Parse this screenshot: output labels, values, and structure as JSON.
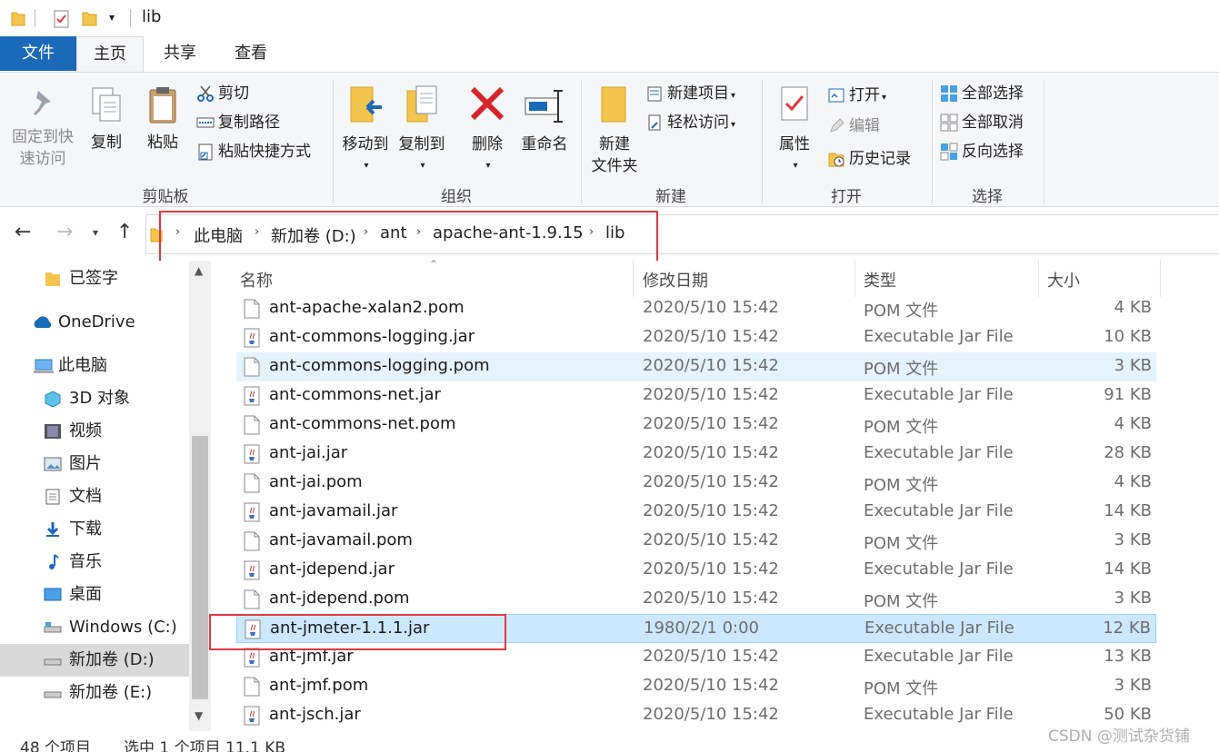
{
  "window": {
    "title": "lib"
  },
  "tabs": [
    {
      "label": "文件"
    },
    {
      "label": "主页"
    },
    {
      "label": "共享"
    },
    {
      "label": "查看"
    }
  ],
  "ribbon": {
    "clipboard": {
      "pin_line1": "固定到快",
      "pin_line2": "速访问",
      "copy": "复制",
      "paste": "粘贴",
      "cut": "剪切",
      "copy_path": "复制路径",
      "paste_shortcut": "粘贴快捷方式",
      "group": "剪贴板"
    },
    "organize": {
      "move_to": "移动到",
      "copy_to": "复制到",
      "delete": "删除",
      "rename": "重命名",
      "group": "组织"
    },
    "new": {
      "new_folder_line1": "新建",
      "new_folder_line2": "文件夹",
      "new_item": "新建项目",
      "easy_access": "轻松访问",
      "group": "新建"
    },
    "open": {
      "properties": "属性",
      "open": "打开",
      "edit": "编辑",
      "history": "历史记录",
      "group": "打开"
    },
    "select": {
      "select_all": "全部选择",
      "select_none": "全部取消",
      "invert": "反向选择",
      "group": "选择"
    }
  },
  "address": {
    "crumbs": [
      "此电脑",
      "新加卷 (D:)",
      "ant",
      "apache-ant-1.9.15",
      "lib"
    ]
  },
  "nav": {
    "items": [
      {
        "label": "已签字",
        "icon": "folder-icon"
      },
      {
        "label": "OneDrive",
        "icon": "cloud-icon"
      },
      {
        "label": "此电脑",
        "icon": "computer-icon"
      },
      {
        "label": "3D 对象",
        "icon": "cube-icon"
      },
      {
        "label": "视频",
        "icon": "video-icon"
      },
      {
        "label": "图片",
        "icon": "picture-icon"
      },
      {
        "label": "文档",
        "icon": "document-icon"
      },
      {
        "label": "下载",
        "icon": "download-icon"
      },
      {
        "label": "音乐",
        "icon": "music-icon"
      },
      {
        "label": "桌面",
        "icon": "desktop-icon"
      },
      {
        "label": "Windows (C:)",
        "icon": "drive-icon"
      },
      {
        "label": "新加卷 (D:)",
        "icon": "drive-icon"
      },
      {
        "label": "新加卷 (E:)",
        "icon": "drive-icon"
      }
    ]
  },
  "columns": {
    "name": "名称",
    "date": "修改日期",
    "type": "类型",
    "size": "大小"
  },
  "files": [
    {
      "name": "ant-apache-xalan2.pom",
      "date": "2020/5/10 15:42",
      "type": "POM 文件",
      "size": "4 KB",
      "kind": "pom"
    },
    {
      "name": "ant-commons-logging.jar",
      "date": "2020/5/10 15:42",
      "type": "Executable Jar File",
      "size": "10 KB",
      "kind": "jar"
    },
    {
      "name": "ant-commons-logging.pom",
      "date": "2020/5/10 15:42",
      "type": "POM 文件",
      "size": "3 KB",
      "kind": "pom"
    },
    {
      "name": "ant-commons-net.jar",
      "date": "2020/5/10 15:42",
      "type": "Executable Jar File",
      "size": "91 KB",
      "kind": "jar"
    },
    {
      "name": "ant-commons-net.pom",
      "date": "2020/5/10 15:42",
      "type": "POM 文件",
      "size": "4 KB",
      "kind": "pom"
    },
    {
      "name": "ant-jai.jar",
      "date": "2020/5/10 15:42",
      "type": "Executable Jar File",
      "size": "28 KB",
      "kind": "jar"
    },
    {
      "name": "ant-jai.pom",
      "date": "2020/5/10 15:42",
      "type": "POM 文件",
      "size": "4 KB",
      "kind": "pom"
    },
    {
      "name": "ant-javamail.jar",
      "date": "2020/5/10 15:42",
      "type": "Executable Jar File",
      "size": "14 KB",
      "kind": "jar"
    },
    {
      "name": "ant-javamail.pom",
      "date": "2020/5/10 15:42",
      "type": "POM 文件",
      "size": "3 KB",
      "kind": "pom"
    },
    {
      "name": "ant-jdepend.jar",
      "date": "2020/5/10 15:42",
      "type": "Executable Jar File",
      "size": "14 KB",
      "kind": "jar"
    },
    {
      "name": "ant-jdepend.pom",
      "date": "2020/5/10 15:42",
      "type": "POM 文件",
      "size": "3 KB",
      "kind": "pom"
    },
    {
      "name": "ant-jmeter-1.1.1.jar",
      "date": "1980/2/1 0:00",
      "type": "Executable Jar File",
      "size": "12 KB",
      "kind": "jar"
    },
    {
      "name": "ant-jmf.jar",
      "date": "2020/5/10 15:42",
      "type": "Executable Jar File",
      "size": "13 KB",
      "kind": "jar"
    },
    {
      "name": "ant-jmf.pom",
      "date": "2020/5/10 15:42",
      "type": "POM 文件",
      "size": "3 KB",
      "kind": "pom"
    },
    {
      "name": "ant-jsch.jar",
      "date": "2020/5/10 15:42",
      "type": "Executable Jar File",
      "size": "50 KB",
      "kind": "jar"
    }
  ],
  "status": {
    "count": "48 个项目",
    "selection": "选中 1 个项目  11.1 KB"
  },
  "watermark": "CSDN @测试杂货铺",
  "colors": {
    "accent": "#1a6ab9",
    "highlight": "#e0383e",
    "selected_row": "#cce8ff",
    "hover_row": "#e5f3ff"
  }
}
